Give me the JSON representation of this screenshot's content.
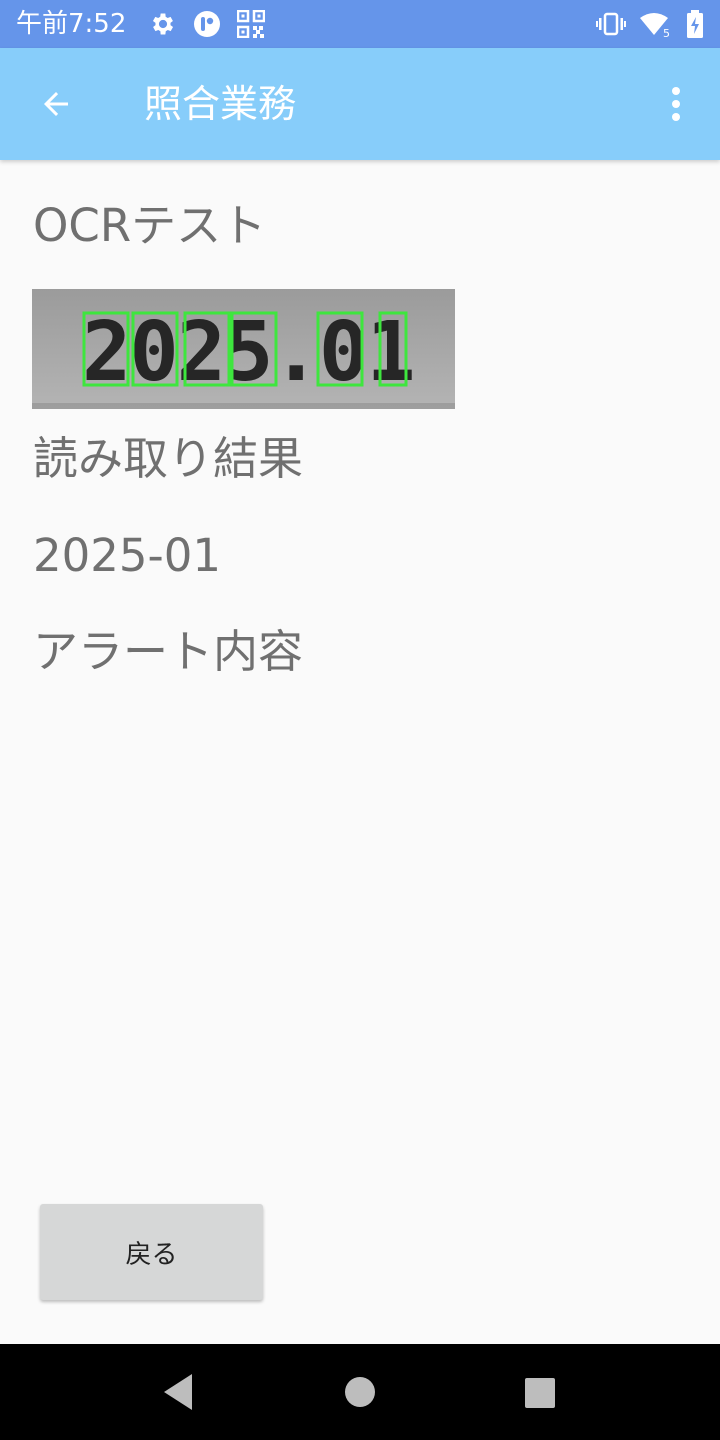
{
  "status_bar": {
    "time": "午前7:52",
    "icons": [
      "settings-gear-icon",
      "app-notification-icon",
      "qr-code-icon",
      "vibrate-icon",
      "wifi-icon",
      "battery-charging-icon"
    ],
    "wifi_badge": "5"
  },
  "app_bar": {
    "title": "照合業務",
    "back_icon": "arrow-left-icon",
    "menu_icon": "more-vert-icon"
  },
  "content": {
    "ocr_label": "OCRテスト",
    "ocr_image_text": "2025.01",
    "result_label": "読み取り結果",
    "result_value": "2025-01",
    "alert_label": "アラート内容",
    "return_button": "戻る"
  },
  "nav_bar": {
    "buttons": [
      "back-triangle-icon",
      "home-circle-icon",
      "recents-square-icon"
    ]
  },
  "colors": {
    "status_bar": "#6595ea",
    "app_bar": "#87cdfa",
    "background": "#fafafa",
    "text": "#707070",
    "button": "#d6d7d7",
    "ocr_box": "#3ee63e"
  }
}
